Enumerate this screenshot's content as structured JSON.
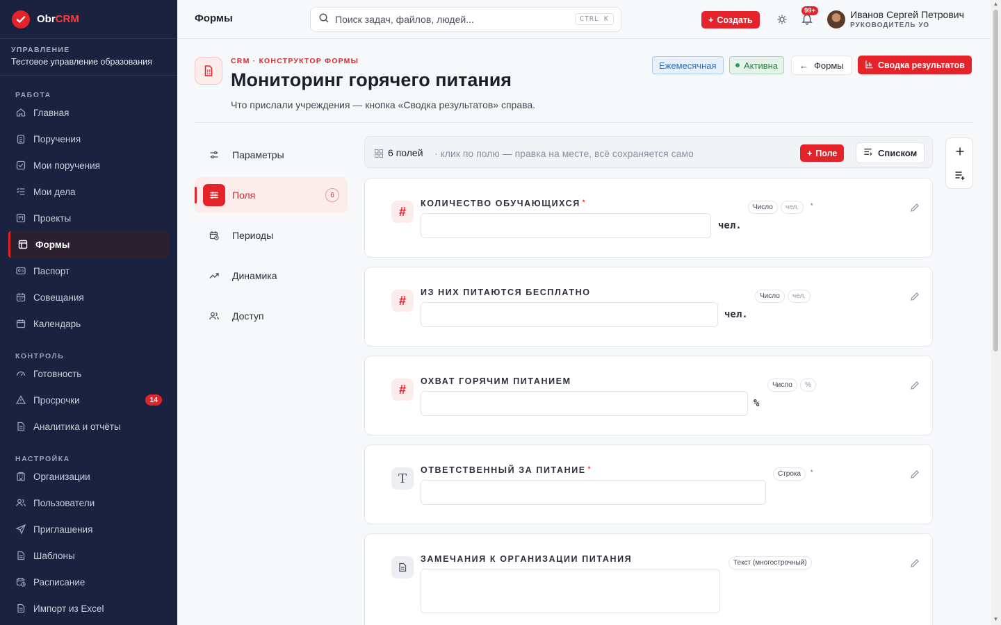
{
  "brand": {
    "name_a": "Obr",
    "name_b": "CRM"
  },
  "org": {
    "title": "УПРАВЛЕНИЕ",
    "name": "Тестовое управление образования"
  },
  "sidebar": {
    "sections": [
      {
        "title": "РАБОТА",
        "items": [
          "Главная",
          "Поручения",
          "Мои поручения",
          "Мои дела",
          "Проекты",
          "Формы",
          "Паспорт",
          "Совещания",
          "Календарь"
        ]
      },
      {
        "title": "КОНТРОЛЬ",
        "items": [
          "Готовность",
          "Просрочки",
          "Аналитика и отчёты"
        ]
      },
      {
        "title": "НАСТРОЙКА",
        "items": [
          "Организации",
          "Пользователи",
          "Приглашения",
          "Шаблоны",
          "Расписание",
          "Импорт из Excel"
        ]
      }
    ],
    "overdue_badge": "14"
  },
  "topbar": {
    "title": "Формы",
    "search_placeholder": "Поиск задач, файлов, людей...",
    "shortcut": "CTRL K",
    "create_label": "Создать",
    "notif_badge": "99+",
    "user_name": "Иванов Сергей Петрович",
    "user_role": "РУКОВОДИТЕЛЬ УО"
  },
  "header": {
    "crumb": "CRM · КОНСТРУКТОР ФОРМЫ",
    "title": "Мониторинг горячего питания",
    "subtitle": "Что прислали учреждения — кнопка «Сводка результатов» справа.",
    "pill_period": "Ежемесячная",
    "pill_status": "Активна",
    "back_label": "Формы",
    "summary_label": "Сводка результатов"
  },
  "tabs": [
    {
      "label": "Параметры"
    },
    {
      "label": "Поля",
      "count": "6"
    },
    {
      "label": "Периоды"
    },
    {
      "label": "Динамика"
    },
    {
      "label": "Доступ"
    }
  ],
  "toolbar": {
    "count": "6 полей",
    "hint": "· клик по полю — правка на месте, всё сохраняется само",
    "add_label": "Поле",
    "list_label": "Списком"
  },
  "fields": [
    {
      "label": "КОЛИЧЕСТВО ОБУЧАЮЩИХСЯ",
      "required": "*",
      "type": "Число",
      "unit": "чел."
    },
    {
      "label": "ИЗ НИХ ПИТАЮТСЯ БЕСПЛАТНО",
      "type": "Число",
      "unit": "чел."
    },
    {
      "label": "ОХВАТ ГОРЯЧИМ ПИТАНИЕМ",
      "type": "Число",
      "unit": "%"
    },
    {
      "label": "ОТВЕТСТВЕННЫЙ ЗА ПИТАНИЕ",
      "required": "*",
      "type": "Строка"
    },
    {
      "label": "ЗАМЕЧАНИЯ К ОРГАНИЗАЦИИ ПИТАНИЯ",
      "type": "Текст (многострочный)"
    }
  ],
  "colors": {
    "accent": "#e5232b",
    "sidebar": "#1b2240"
  }
}
